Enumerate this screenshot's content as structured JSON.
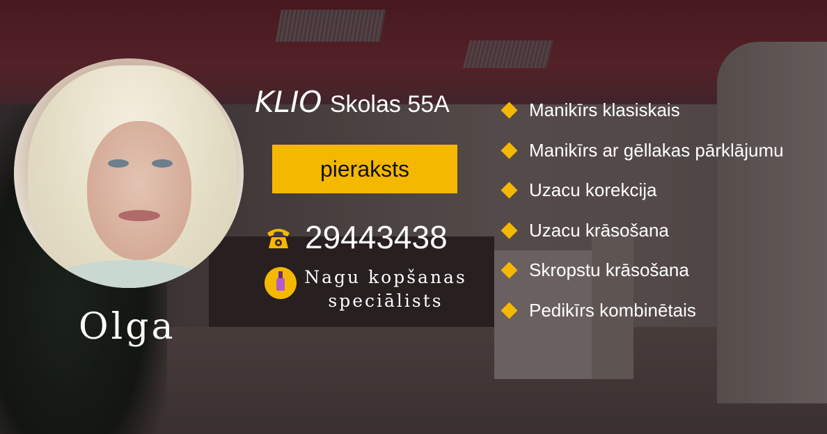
{
  "profile": {
    "name": "Olga",
    "role": "Nagu kopšanas speciālists"
  },
  "location": {
    "brand": "KLIO",
    "address": "Skolas 55A"
  },
  "booking": {
    "button_label": "pieraksts"
  },
  "contact": {
    "phone": "29443438",
    "phone_icon": "☎"
  },
  "services": [
    "Manikīrs klasiskais",
    "Manikīrs ar gēllakas pārklājumu",
    "Uzacu korekcija",
    "Uzacu krāsošana",
    "Skropstu krāsošana",
    "Pedikīrs kombinētais"
  ],
  "colors": {
    "accent": "#f5b800",
    "text": "#ffffff"
  }
}
